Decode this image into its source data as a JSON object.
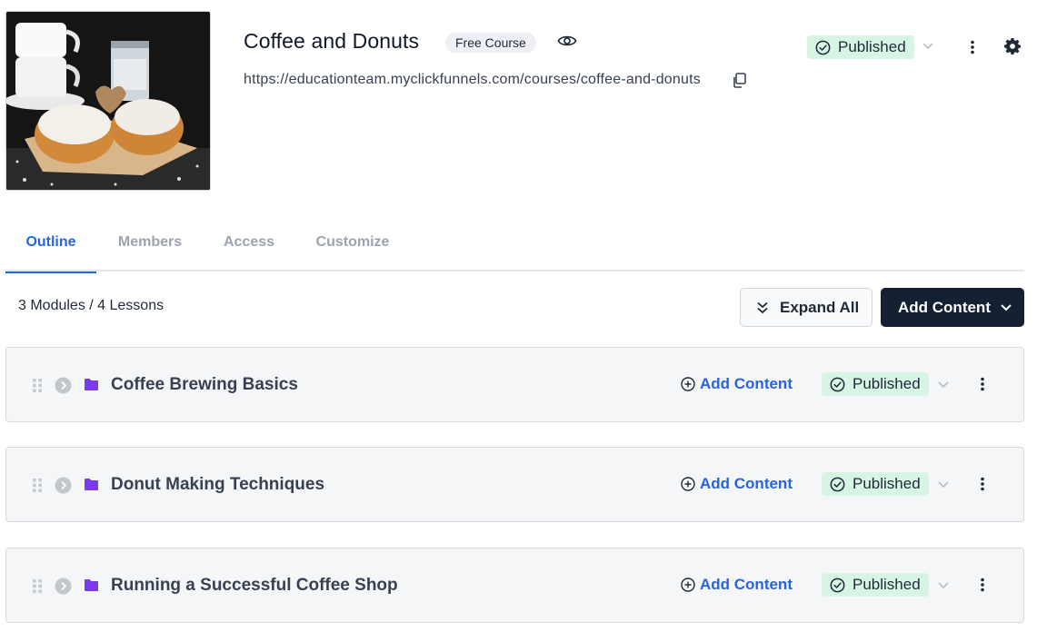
{
  "course": {
    "title": "Coffee and Donuts",
    "badge": "Free Course",
    "url": "https://educationteam.myclickfunnels.com/courses/coffee-and-donuts",
    "status": "Published"
  },
  "tabs": [
    {
      "label": "Outline",
      "active": true
    },
    {
      "label": "Members",
      "active": false
    },
    {
      "label": "Access",
      "active": false
    },
    {
      "label": "Customize",
      "active": false
    }
  ],
  "outline": {
    "summary": "3 Modules / 4 Lessons",
    "expand_all_label": "Expand All",
    "add_content_label": "Add Content"
  },
  "modules": [
    {
      "title": "Coffee Brewing Basics",
      "add_label": "Add Content",
      "status": "Published"
    },
    {
      "title": "Donut Making Techniques",
      "add_label": "Add Content",
      "status": "Published"
    },
    {
      "title": "Running a Successful Coffee Shop",
      "add_label": "Add Content",
      "status": "Published"
    }
  ],
  "icons": {
    "preview": "eye-icon",
    "copy": "copy-icon",
    "status": "check-circle-icon",
    "dropdown": "chevron-down-icon",
    "menu": "kebab-menu-icon",
    "settings": "gear-icon",
    "drag": "drag-handle-icon",
    "expand": "chevron-right-circle-icon",
    "module": "folder-icon",
    "add": "plus-circle-icon",
    "expand_all": "double-chevron-down-icon"
  },
  "colors": {
    "accent": "#2563eb",
    "published_bg": "#d7f5e4",
    "primary_button": "#162033",
    "folder": "#7c3aed",
    "module_bg": "#f5f6f8"
  }
}
